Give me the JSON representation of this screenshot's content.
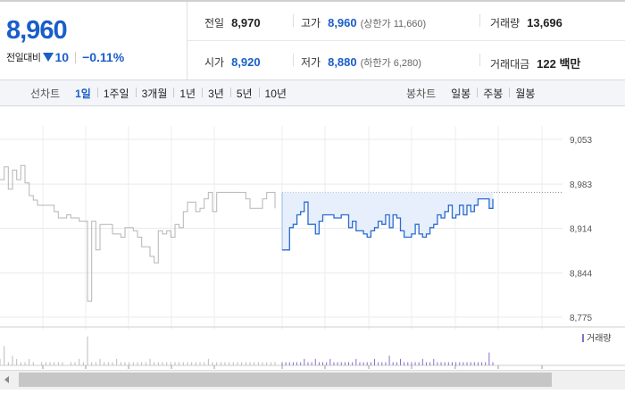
{
  "summary": {
    "current_price": "8,960",
    "change_label": "전일대비",
    "change_value": "10",
    "change_rate": "−0.11%",
    "stats_row1": [
      {
        "label": "전일",
        "value": "8,970",
        "sub": ""
      },
      {
        "label": "고가",
        "value": "8,960",
        "sub": "(상한가 11,660)"
      },
      {
        "label": "거래량",
        "value": "13,696",
        "sub": ""
      }
    ],
    "stats_row2": [
      {
        "label": "시가",
        "value": "8,920",
        "sub": ""
      },
      {
        "label": "저가",
        "value": "8,880",
        "sub": "(하한가 6,280)"
      },
      {
        "label": "거래대금",
        "value": "122 백만",
        "sub": ""
      }
    ]
  },
  "toolbar": {
    "line_chart_label": "선차트",
    "line_periods": [
      "1일",
      "1주일",
      "3개월",
      "1년",
      "3년",
      "5년",
      "10년"
    ],
    "active_period": "1일",
    "candle_chart_label": "봉차트",
    "candle_periods": [
      "일봉",
      "주봉",
      "월봉"
    ]
  },
  "chart_data": {
    "type": "line",
    "y_ticks": [
      "9,053",
      "8,983",
      "8,914",
      "8,844",
      "8,775"
    ],
    "y_tick_values": [
      9053,
      8983,
      8914,
      8844,
      8775
    ],
    "ylim": [
      8775,
      9053
    ],
    "reference_price": 8970,
    "volume_legend": "거래량",
    "grid": true,
    "series": [
      {
        "values": [
          8990,
          9010,
          8975,
          9005,
          8990,
          9012,
          8985,
          8965,
          8958,
          8950,
          8950,
          8950,
          8950,
          8940,
          8930,
          8930,
          8935,
          8930,
          8930,
          8925,
          8925,
          8800,
          8925,
          8880,
          8920,
          8920,
          8920,
          8905,
          8905,
          8900,
          8915,
          8915,
          8910,
          8900,
          8885,
          8885,
          8870,
          8860,
          8910,
          8905,
          8910,
          8900,
          8920,
          8915,
          8940,
          8955,
          8955,
          8940,
          8945,
          8960,
          8970,
          8940,
          8970,
          8970,
          8970,
          8970,
          8970,
          8970,
          8970,
          8960,
          8945,
          8945,
          8945,
          8960,
          8970,
          8970,
          8945
        ]
      },
      {
        "values": [
          8880,
          8880,
          8915,
          8920,
          8935,
          8940,
          8955,
          8920,
          8920,
          8905,
          8925,
          8935,
          8935,
          8935,
          8930,
          8930,
          8935,
          8935,
          8915,
          8925,
          8910,
          8910,
          8905,
          8900,
          8910,
          8915,
          8925,
          8920,
          8935,
          8915,
          8935,
          8930,
          8910,
          8900,
          8900,
          8905,
          8920,
          8905,
          8900,
          8905,
          8915,
          8920,
          8935,
          8930,
          8940,
          8950,
          8930,
          8935,
          8950,
          8935,
          8950,
          8940,
          8950,
          8960,
          8960,
          8960,
          8945,
          8960
        ]
      }
    ],
    "volume_session1": [
      2,
      6,
      1,
      3,
      2,
      1,
      1,
      2,
      1,
      0,
      1,
      1,
      1,
      1,
      1,
      1,
      0,
      1,
      1,
      2,
      1,
      9,
      1,
      1,
      2,
      1,
      1,
      1,
      2,
      1,
      1,
      1,
      1,
      1,
      1,
      1,
      2,
      1,
      1,
      1,
      1,
      1,
      1,
      1,
      1,
      1,
      1,
      1,
      1,
      1,
      2,
      1,
      1,
      1,
      1,
      1,
      1,
      1,
      1,
      1,
      1,
      1,
      1,
      1,
      1,
      1,
      1
    ],
    "volume_session2": [
      1,
      1,
      1,
      1,
      1,
      1,
      2,
      1,
      1,
      2,
      1,
      1,
      1,
      2,
      1,
      1,
      1,
      1,
      1,
      1,
      2,
      1,
      1,
      1,
      1,
      2,
      1,
      1,
      1,
      3,
      1,
      1,
      2,
      1,
      1,
      1,
      1,
      1,
      2,
      1,
      1,
      2,
      1,
      1,
      1,
      1,
      1,
      1,
      1,
      1,
      1,
      1,
      1,
      1,
      1,
      1,
      4,
      1
    ]
  }
}
